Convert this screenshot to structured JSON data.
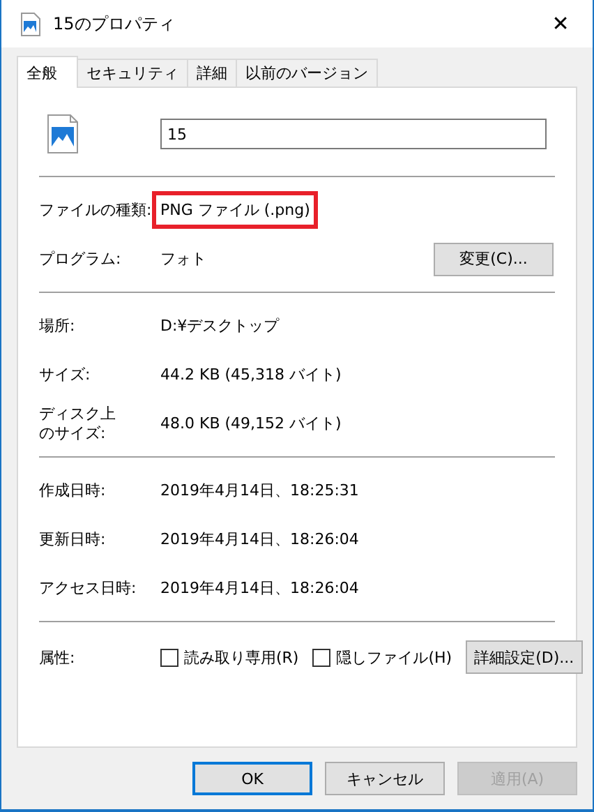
{
  "window": {
    "title": "15のプロパティ",
    "close": "✕"
  },
  "tabs": [
    {
      "label": "全般",
      "selected": true
    },
    {
      "label": "セキュリティ",
      "selected": false
    },
    {
      "label": "詳細",
      "selected": false
    },
    {
      "label": "以前のバージョン",
      "selected": false
    }
  ],
  "file_name": {
    "value": "15"
  },
  "sections": [
    [
      {
        "label": "ファイルの種類:",
        "value": "PNG ファイル (.png)",
        "highlighted": true
      },
      {
        "label": "プログラム:",
        "value": "フォト",
        "highlighted": false,
        "button": "変更(C)..."
      }
    ],
    [
      {
        "label": "場所:",
        "value": "D:¥デスクトップ",
        "highlighted": false
      },
      {
        "label": "サイズ:",
        "value": "44.2 KB (45,318 バイト)",
        "highlighted": false
      },
      {
        "label": [
          "ディスク上",
          "のサイズ:"
        ],
        "value": "48.0 KB (49,152 バイト)",
        "highlighted": false
      }
    ],
    [
      {
        "label": "作成日時:",
        "value": "2019年4月14日、18:25:31",
        "highlighted": false
      },
      {
        "label": "更新日時:",
        "value": "2019年4月14日、18:26:04",
        "highlighted": false
      },
      {
        "label": "アクセス日時:",
        "value": "2019年4月14日、18:26:04",
        "highlighted": false
      }
    ]
  ],
  "attributes": {
    "label": "属性:",
    "checkboxes": [
      {
        "label": "読み取り専用(R)",
        "checked": false
      },
      {
        "label": "隠しファイル(H)",
        "checked": false
      }
    ],
    "button": "詳細設定(D)..."
  },
  "buttons": [
    {
      "label": "OK",
      "default": true,
      "disabled": false
    },
    {
      "label": "キャンセル",
      "default": false,
      "disabled": false
    },
    {
      "label": "適用(A)",
      "default": false,
      "disabled": true
    }
  ]
}
